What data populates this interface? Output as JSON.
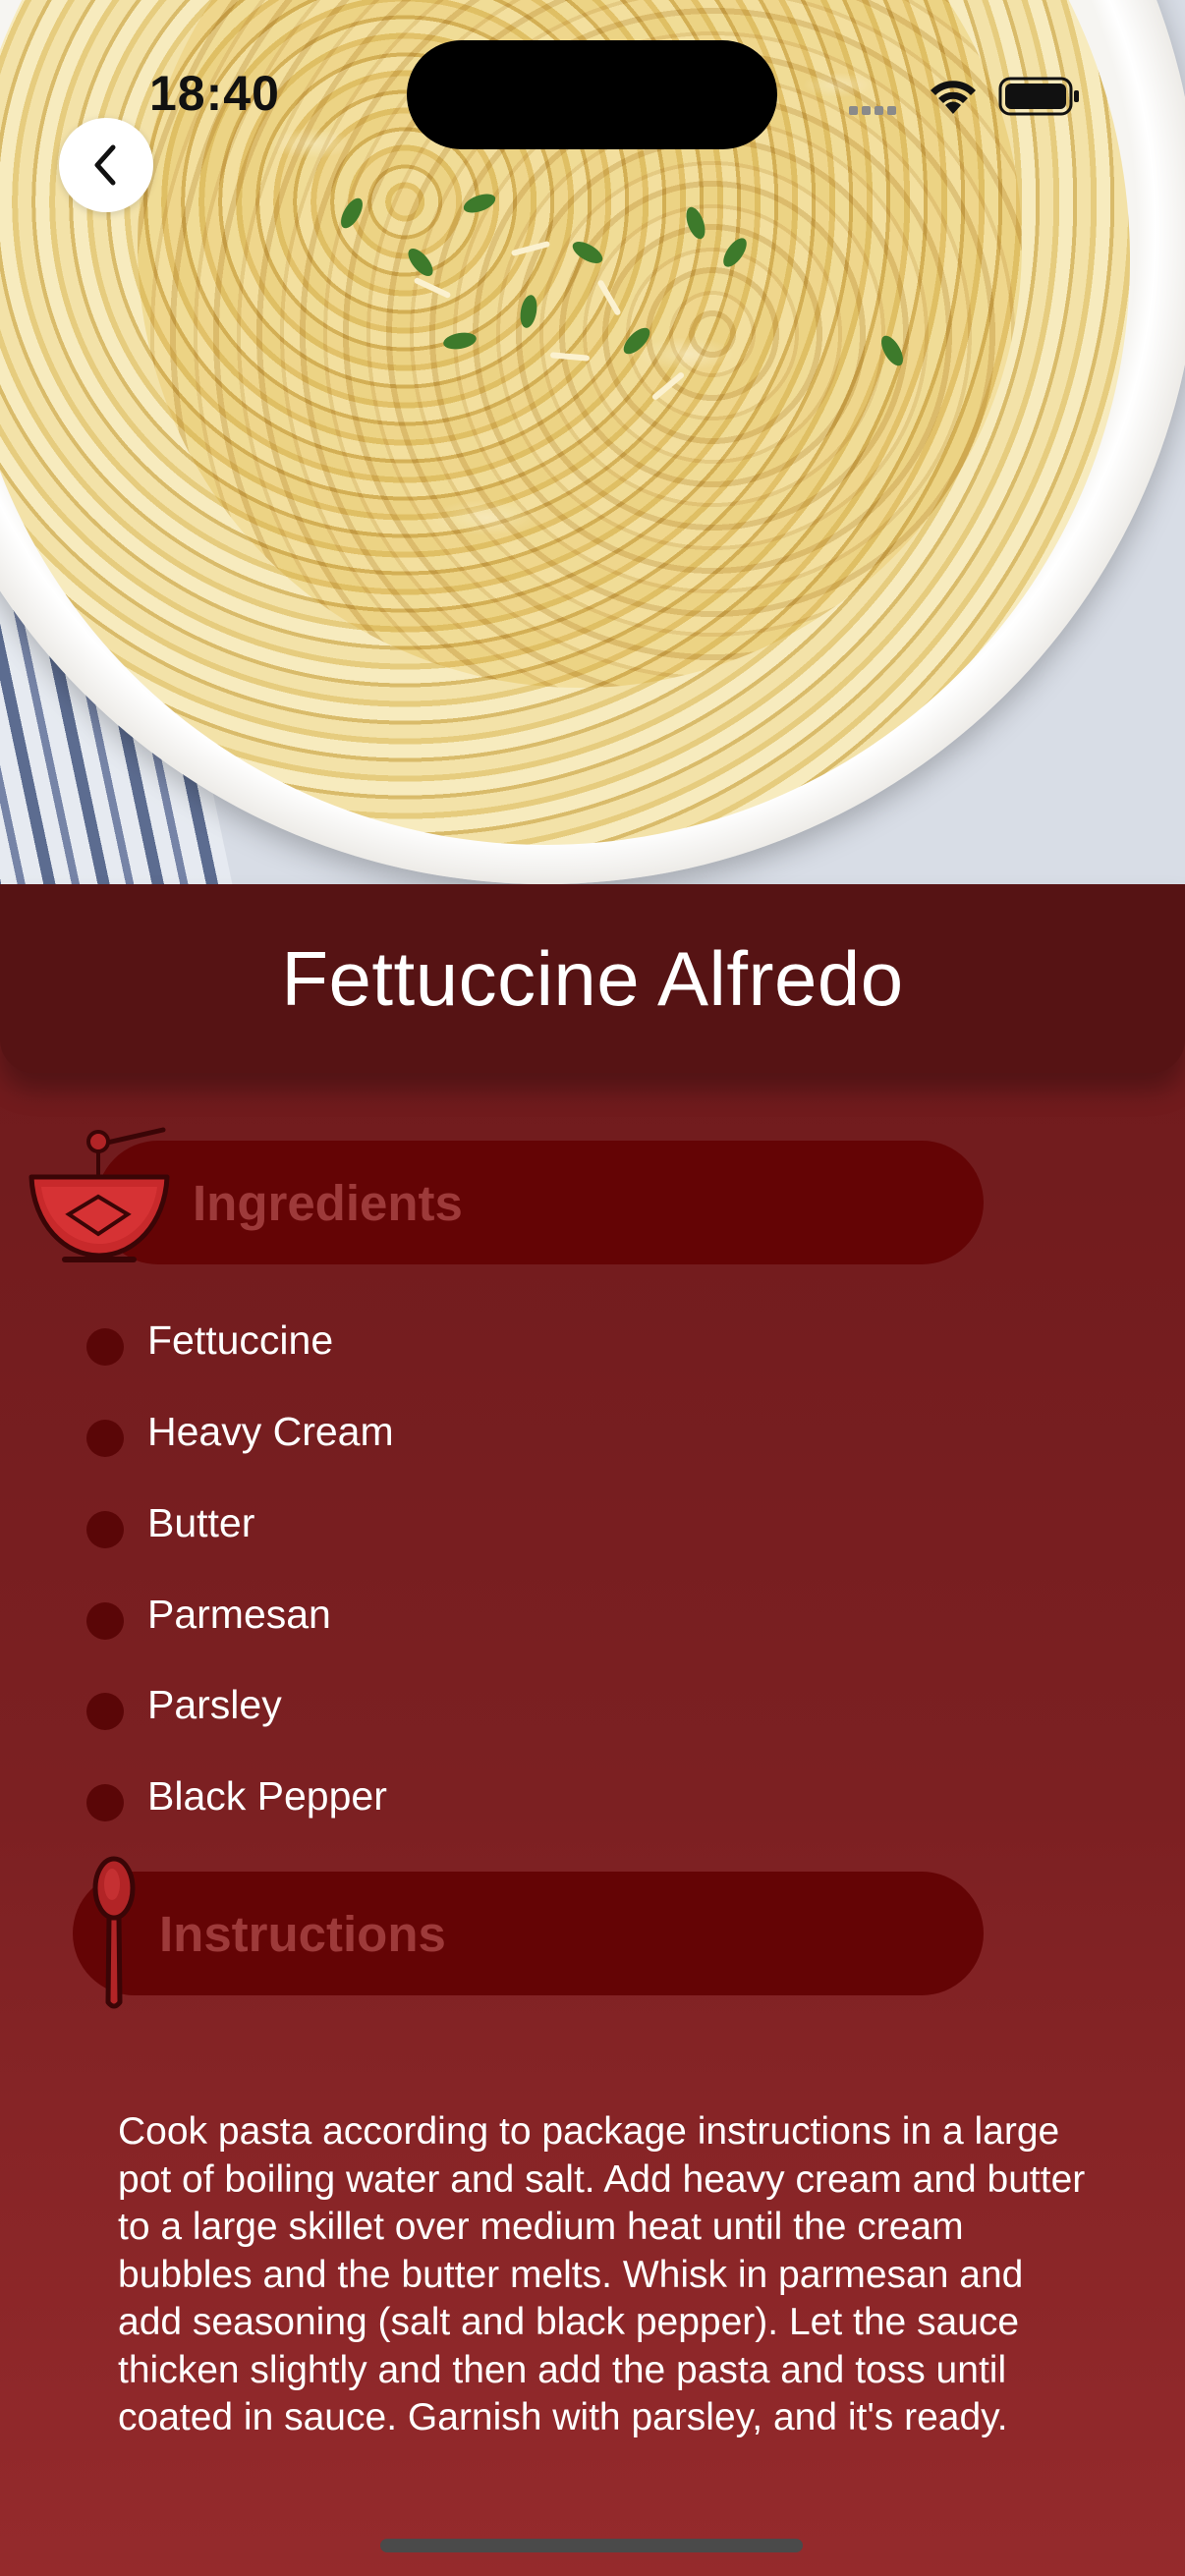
{
  "status_bar": {
    "time": "18:40"
  },
  "recipe": {
    "title": "Fettuccine Alfredo"
  },
  "sections": {
    "ingredients_label": "Ingredients",
    "instructions_label": "Instructions"
  },
  "ingredients": [
    "Fettuccine",
    "Heavy Cream",
    "Butter",
    "Parmesan",
    "Parsley",
    "Black Pepper"
  ],
  "instructions": "Cook pasta according to package instructions in a large pot of boiling water and salt. Add heavy cream and butter to a large skillet over medium heat until the cream bubbles and the butter melts. Whisk in parmesan and add seasoning (salt and black pepper). Let the sauce thicken slightly and then add the pasta and toss until coated in sauce. Garnish with parsley, and it's ready.",
  "icons": {
    "back": "chevron-left-icon",
    "wifi": "wifi-icon",
    "battery": "battery-icon",
    "ingredients_section": "mixing-bowl-icon",
    "instructions_section": "spoon-icon"
  },
  "colors": {
    "title_banner": "#561314",
    "section_pill": "#640405",
    "section_label": "#9d3a3a",
    "bullet": "#5a0607",
    "background_top": "#5e1517",
    "background_bottom": "#952a2c"
  }
}
